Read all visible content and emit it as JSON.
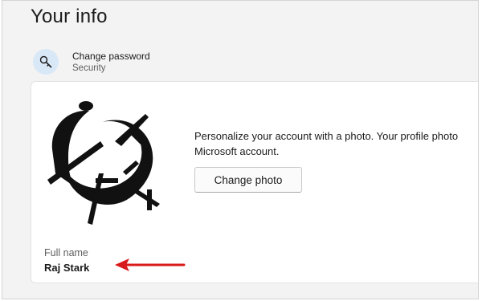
{
  "page": {
    "title": "Your info"
  },
  "password_row": {
    "title": "Change password",
    "subtitle": "Security",
    "icon": "key-icon"
  },
  "profile": {
    "description_line1": "Personalize your account with a photo. Your profile photo",
    "description_line2": "Microsoft account.",
    "change_photo_label": "Change photo",
    "full_name_label": "Full name",
    "full_name_value": "Raj Stark"
  },
  "colors": {
    "background": "#f3f3f3",
    "card": "#ffffff",
    "icon_circle": "#d9e8f7",
    "annotation_arrow": "#d81b1b"
  }
}
